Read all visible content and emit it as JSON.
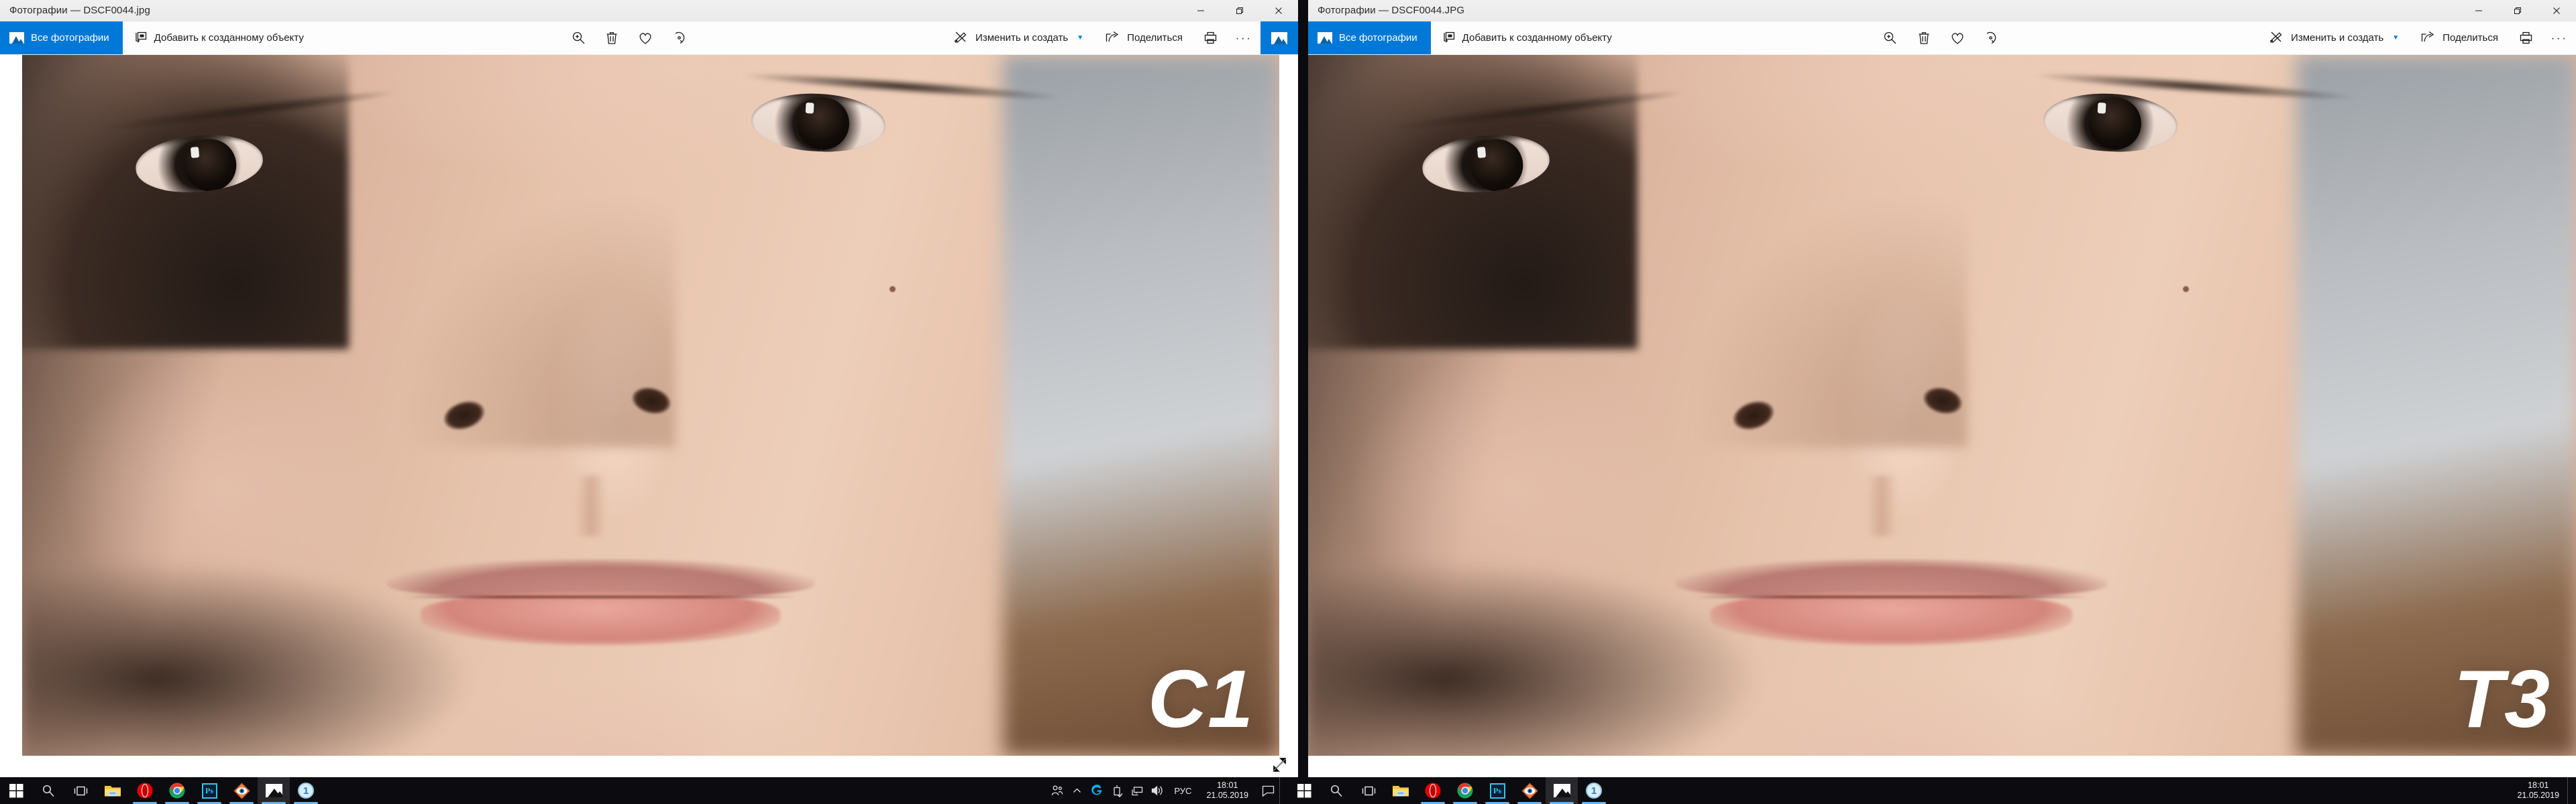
{
  "windows": [
    {
      "title": "Фотографии — DSCF0044.jpg",
      "watermark": "C1",
      "toolbar": {
        "all_photos": "Все фотографии",
        "add_to_album": "Добавить к созданному объекту",
        "edit_create": "Изменить и создать",
        "share": "Поделиться",
        "zoom_icon": "zoom-in-icon",
        "delete_icon": "trash-icon",
        "favorite_icon": "heart-icon",
        "rotate_icon": "rotate-icon",
        "print_icon": "print-icon",
        "more_icon": "more-ellipsis-icon",
        "chevron_icon": "chevron-down-icon"
      },
      "controls": {
        "minimize": "minimize-icon",
        "restore": "restore-icon",
        "close": "close-icon"
      }
    },
    {
      "title": "Фотографии — DSCF0044.JPG",
      "watermark": "T3",
      "toolbar": {
        "all_photos": "Все фотографии",
        "add_to_album": "Добавить к созданному объекту",
        "edit_create": "Изменить и создать",
        "share": "Поделиться",
        "zoom_icon": "zoom-in-icon",
        "delete_icon": "trash-icon",
        "favorite_icon": "heart-icon",
        "rotate_icon": "rotate-icon",
        "print_icon": "print-icon",
        "more_icon": "more-ellipsis-icon",
        "chevron_icon": "chevron-down-icon"
      },
      "controls": {
        "minimize": "minimize-icon",
        "restore": "restore-icon",
        "close": "close-icon"
      }
    }
  ],
  "taskbar": {
    "apps": [
      {
        "name": "start-button",
        "icon": "windows-logo-icon",
        "active": false,
        "running": false
      },
      {
        "name": "search-button",
        "icon": "search-icon",
        "active": false,
        "running": false
      },
      {
        "name": "task-view-button",
        "icon": "task-view-icon",
        "active": false,
        "running": false
      },
      {
        "name": "file-explorer",
        "icon": "folder-icon",
        "active": false,
        "running": false
      },
      {
        "name": "opera-browser",
        "icon": "opera-icon",
        "active": false,
        "running": true
      },
      {
        "name": "google-chrome",
        "icon": "chrome-icon",
        "active": false,
        "running": true
      },
      {
        "name": "adobe-photoshop",
        "icon": "photoshop-icon",
        "active": false,
        "running": true
      },
      {
        "name": "acdsee-photo-editor",
        "icon": "acdsee-eye-icon",
        "active": false,
        "running": true
      },
      {
        "name": "microsoft-photos",
        "icon": "photos-icon",
        "active": true,
        "running": true
      },
      {
        "name": "capture-one",
        "icon": "number-one-icon",
        "active": false,
        "running": true
      }
    ],
    "tray": {
      "people_icon": "people-icon",
      "show_hidden_icon": "chevron-up-icon",
      "logitech_icon": "logitech-g-icon",
      "usb_icon": "usb-safe-remove-icon",
      "network_icon": "network-icon",
      "volume_icon": "volume-icon",
      "language": "РУС",
      "time": "18:01",
      "date": "21.05.2019",
      "action_center_icon": "notification-icon"
    }
  },
  "secondary_taskbar": {
    "apps": [
      {
        "name": "start-button",
        "icon": "windows-logo-icon",
        "active": false,
        "running": false
      },
      {
        "name": "search-button",
        "icon": "search-icon",
        "active": false,
        "running": false
      },
      {
        "name": "task-view-button",
        "icon": "task-view-icon",
        "active": false,
        "running": false
      },
      {
        "name": "file-explorer",
        "icon": "folder-icon",
        "active": false,
        "running": false
      },
      {
        "name": "opera-browser",
        "icon": "opera-icon",
        "active": false,
        "running": true
      },
      {
        "name": "google-chrome",
        "icon": "chrome-icon",
        "active": false,
        "running": true
      },
      {
        "name": "adobe-photoshop",
        "icon": "photoshop-icon",
        "active": false,
        "running": true
      },
      {
        "name": "acdsee-photo-editor",
        "icon": "acdsee-eye-icon",
        "active": false,
        "running": true
      },
      {
        "name": "microsoft-photos",
        "icon": "photos-icon",
        "active": true,
        "running": true
      },
      {
        "name": "capture-one",
        "icon": "number-one-icon",
        "active": false,
        "running": true
      }
    ],
    "tray": {
      "time": "18:01",
      "date": "21.05.2019"
    }
  },
  "colors": {
    "accent": "#0078d7",
    "taskbar": "#0c0c10",
    "titlebar": "#f0f0f0",
    "underline": "#6cb3f0"
  }
}
